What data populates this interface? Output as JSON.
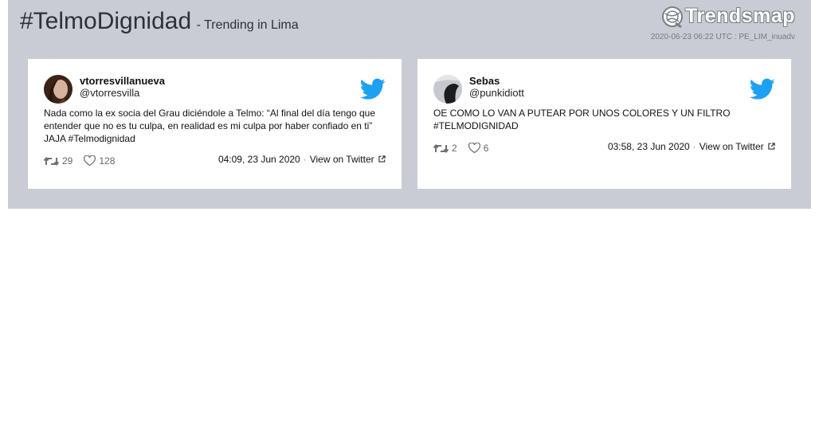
{
  "header": {
    "hashtag": "#TelmoDignidad",
    "subtitle": "- Trending in Lima",
    "brand": "Trendsmap",
    "stamp": "2020-06-23 06:22 UTC : PE_LIM_inuadv"
  },
  "tweets": [
    {
      "name": "vtorresvillanueva",
      "handle": "@vtorresvilla",
      "text": "Nada como la ex socia del Grau diciéndole a Telmo: “Al final del día tengo que entender que no es tu culpa, en realidad es mi culpa por haber confiado en ti” JAJA #Telmodignidad",
      "retweets": "29",
      "likes": "128",
      "time": "04:09, 23 Jun 2020",
      "view_label": "View on Twitter"
    },
    {
      "name": "Sebas",
      "handle": "@punkidiott",
      "text": "OE COMO LO VAN A PUTEAR POR UNOS COLORES Y UN FILTRO #TELMODIGNIDAD",
      "retweets": "2",
      "likes": "6",
      "time": "03:58, 23 Jun 2020",
      "view_label": "View on Twitter"
    }
  ],
  "icons": {
    "bird": "twitter-bird-icon",
    "retweet": "retweet-icon",
    "like": "heart-icon",
    "external": "external-link-icon"
  },
  "colors": {
    "panel": "#c9ccd3",
    "twitter_blue": "#1da1f2"
  }
}
